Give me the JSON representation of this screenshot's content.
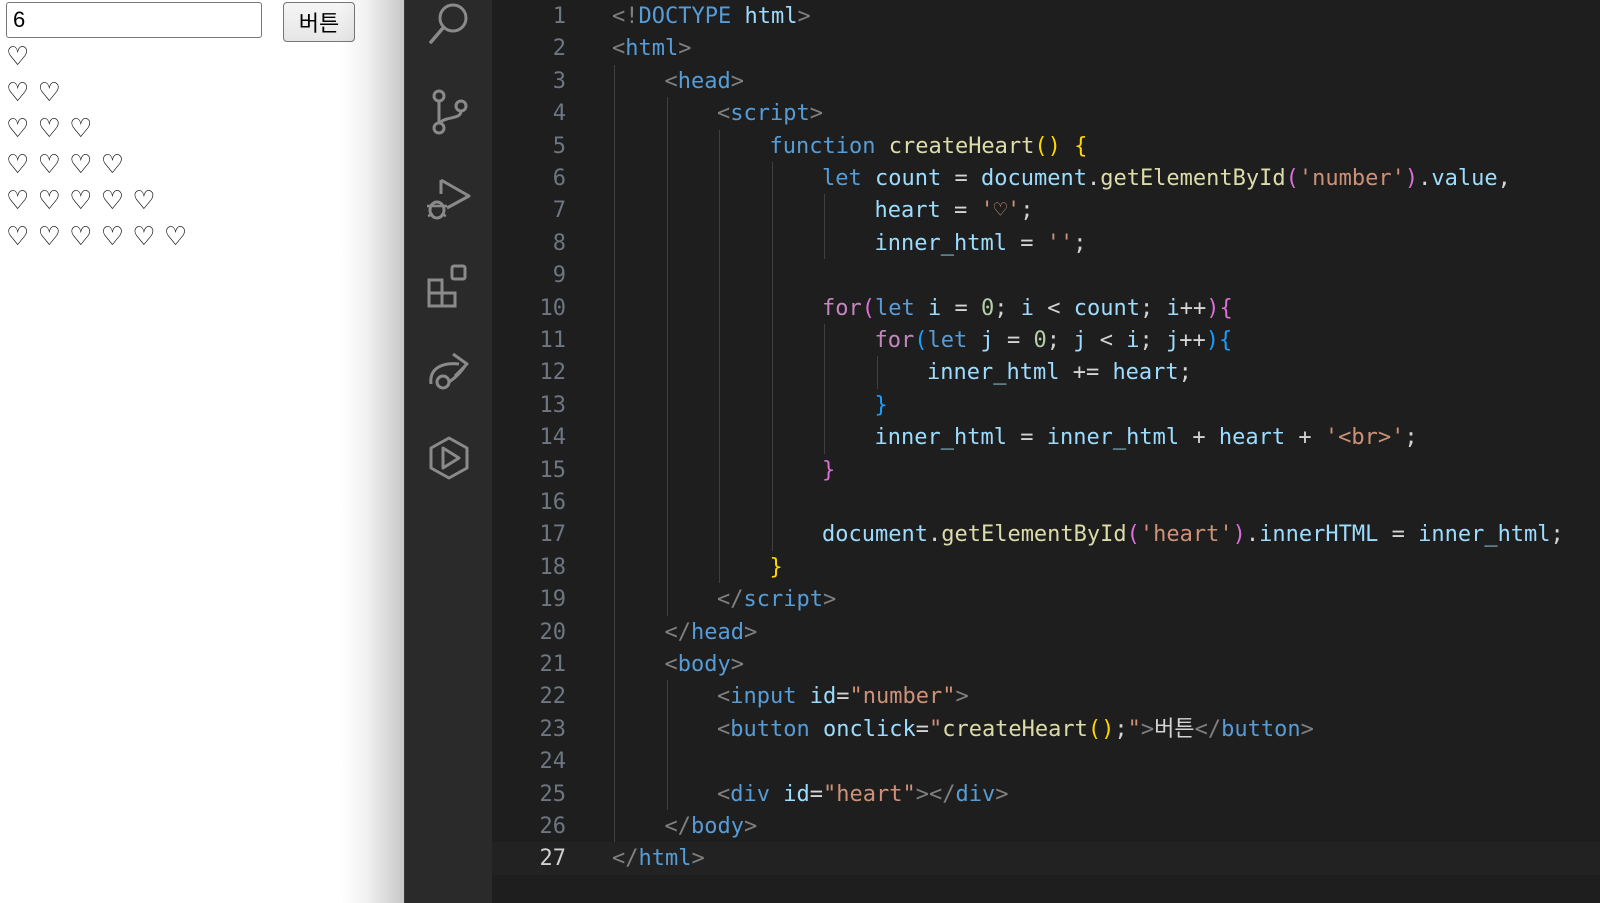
{
  "preview": {
    "input_value": "6",
    "button_label": "버튼",
    "heart_rows": [
      "♡",
      "♡♡",
      "♡♡♡",
      "♡♡♡♡",
      "♡♡♡♡♡",
      "♡♡♡♡♡♡"
    ]
  },
  "activity_bar": {
    "icons": [
      "search-icon",
      "source-control-icon",
      "run-debug-icon",
      "extensions-icon",
      "live-share-icon",
      "remote-explorer-icon"
    ]
  },
  "editor": {
    "active_line": 27,
    "lines": [
      {
        "n": "1",
        "indent": 0,
        "tokens": [
          [
            "br",
            "<!"
          ],
          [
            "tag",
            "DOCTYPE"
          ],
          [
            "txt",
            " "
          ],
          [
            "attr",
            "html"
          ],
          [
            "br",
            ">"
          ]
        ]
      },
      {
        "n": "2",
        "indent": 0,
        "tokens": [
          [
            "br",
            "<"
          ],
          [
            "tag",
            "html"
          ],
          [
            "br",
            ">"
          ]
        ]
      },
      {
        "n": "3",
        "indent": 1,
        "tokens": [
          [
            "br",
            "<"
          ],
          [
            "tag",
            "head"
          ],
          [
            "br",
            ">"
          ]
        ]
      },
      {
        "n": "4",
        "indent": 2,
        "tokens": [
          [
            "br",
            "<"
          ],
          [
            "tag",
            "script"
          ],
          [
            "br",
            ">"
          ]
        ]
      },
      {
        "n": "5",
        "indent": 3,
        "tokens": [
          [
            "kw",
            "function"
          ],
          [
            "txt",
            " "
          ],
          [
            "fn",
            "createHeart"
          ],
          [
            "y",
            "()"
          ],
          [
            "txt",
            " "
          ],
          [
            "y",
            "{"
          ]
        ]
      },
      {
        "n": "6",
        "indent": 4,
        "tokens": [
          [
            "kw",
            "let"
          ],
          [
            "txt",
            " "
          ],
          [
            "var",
            "count"
          ],
          [
            "txt",
            " = "
          ],
          [
            "var",
            "document"
          ],
          [
            "txt",
            "."
          ],
          [
            "fn",
            "getElementById"
          ],
          [
            "p",
            "("
          ],
          [
            "str",
            "'number'"
          ],
          [
            "p",
            ")"
          ],
          [
            "txt",
            "."
          ],
          [
            "var",
            "value"
          ],
          [
            "txt",
            ","
          ]
        ]
      },
      {
        "n": "7",
        "indent": 5,
        "tokens": [
          [
            "var",
            "heart"
          ],
          [
            "txt",
            " = "
          ],
          [
            "str",
            "'♡'"
          ],
          [
            "txt",
            ";"
          ]
        ]
      },
      {
        "n": "8",
        "indent": 5,
        "tokens": [
          [
            "var",
            "inner_html"
          ],
          [
            "txt",
            " = "
          ],
          [
            "str",
            "''"
          ],
          [
            "txt",
            ";"
          ]
        ]
      },
      {
        "n": "9",
        "indent": 4,
        "tokens": []
      },
      {
        "n": "10",
        "indent": 4,
        "tokens": [
          [
            "ctl",
            "for"
          ],
          [
            "p",
            "("
          ],
          [
            "kw",
            "let"
          ],
          [
            "txt",
            " "
          ],
          [
            "var",
            "i"
          ],
          [
            "txt",
            " = "
          ],
          [
            "num",
            "0"
          ],
          [
            "txt",
            "; "
          ],
          [
            "var",
            "i"
          ],
          [
            "txt",
            " < "
          ],
          [
            "var",
            "count"
          ],
          [
            "txt",
            "; "
          ],
          [
            "var",
            "i"
          ],
          [
            "txt",
            "++"
          ],
          [
            "p",
            ")"
          ],
          [
            "p",
            "{"
          ]
        ]
      },
      {
        "n": "11",
        "indent": 5,
        "tokens": [
          [
            "ctl",
            "for"
          ],
          [
            "b",
            "("
          ],
          [
            "kw",
            "let"
          ],
          [
            "txt",
            " "
          ],
          [
            "var",
            "j"
          ],
          [
            "txt",
            " = "
          ],
          [
            "num",
            "0"
          ],
          [
            "txt",
            "; "
          ],
          [
            "var",
            "j"
          ],
          [
            "txt",
            " < "
          ],
          [
            "var",
            "i"
          ],
          [
            "txt",
            "; "
          ],
          [
            "var",
            "j"
          ],
          [
            "txt",
            "++"
          ],
          [
            "b",
            ")"
          ],
          [
            "b",
            "{"
          ]
        ]
      },
      {
        "n": "12",
        "indent": 6,
        "tokens": [
          [
            "var",
            "inner_html"
          ],
          [
            "txt",
            " += "
          ],
          [
            "var",
            "heart"
          ],
          [
            "txt",
            ";"
          ]
        ]
      },
      {
        "n": "13",
        "indent": 5,
        "tokens": [
          [
            "b",
            "}"
          ]
        ]
      },
      {
        "n": "14",
        "indent": 5,
        "tokens": [
          [
            "var",
            "inner_html"
          ],
          [
            "txt",
            " = "
          ],
          [
            "var",
            "inner_html"
          ],
          [
            "txt",
            " + "
          ],
          [
            "var",
            "heart"
          ],
          [
            "txt",
            " + "
          ],
          [
            "str",
            "'<br>'"
          ],
          [
            "txt",
            ";"
          ]
        ]
      },
      {
        "n": "15",
        "indent": 4,
        "tokens": [
          [
            "p",
            "}"
          ]
        ]
      },
      {
        "n": "16",
        "indent": 4,
        "tokens": []
      },
      {
        "n": "17",
        "indent": 4,
        "tokens": [
          [
            "var",
            "document"
          ],
          [
            "txt",
            "."
          ],
          [
            "fn",
            "getElementById"
          ],
          [
            "p",
            "("
          ],
          [
            "str",
            "'heart'"
          ],
          [
            "p",
            ")"
          ],
          [
            "txt",
            "."
          ],
          [
            "var",
            "innerHTML"
          ],
          [
            "txt",
            " = "
          ],
          [
            "var",
            "inner_html"
          ],
          [
            "txt",
            ";"
          ]
        ]
      },
      {
        "n": "18",
        "indent": 3,
        "tokens": [
          [
            "y",
            "}"
          ]
        ]
      },
      {
        "n": "19",
        "indent": 2,
        "tokens": [
          [
            "br",
            "</"
          ],
          [
            "tag",
            "script"
          ],
          [
            "br",
            ">"
          ]
        ]
      },
      {
        "n": "20",
        "indent": 1,
        "tokens": [
          [
            "br",
            "</"
          ],
          [
            "tag",
            "head"
          ],
          [
            "br",
            ">"
          ]
        ]
      },
      {
        "n": "21",
        "indent": 1,
        "tokens": [
          [
            "br",
            "<"
          ],
          [
            "tag",
            "body"
          ],
          [
            "br",
            ">"
          ]
        ]
      },
      {
        "n": "22",
        "indent": 2,
        "tokens": [
          [
            "br",
            "<"
          ],
          [
            "tag",
            "input"
          ],
          [
            "txt",
            " "
          ],
          [
            "attr",
            "id"
          ],
          [
            "txt",
            "="
          ],
          [
            "str",
            "\"number\""
          ],
          [
            "br",
            ">"
          ]
        ]
      },
      {
        "n": "23",
        "indent": 2,
        "tokens": [
          [
            "br",
            "<"
          ],
          [
            "tag",
            "button"
          ],
          [
            "txt",
            " "
          ],
          [
            "attr",
            "onclick"
          ],
          [
            "txt",
            "="
          ],
          [
            "str",
            "\""
          ],
          [
            "fn",
            "createHeart"
          ],
          [
            "y",
            "()"
          ],
          [
            "txt",
            ";"
          ],
          [
            "str",
            "\""
          ],
          [
            "br",
            ">"
          ],
          [
            "txt",
            "버튼"
          ],
          [
            "br",
            "</"
          ],
          [
            "tag",
            "button"
          ],
          [
            "br",
            ">"
          ]
        ]
      },
      {
        "n": "24",
        "indent": 2,
        "tokens": []
      },
      {
        "n": "25",
        "indent": 2,
        "tokens": [
          [
            "br",
            "<"
          ],
          [
            "tag",
            "div"
          ],
          [
            "txt",
            " "
          ],
          [
            "attr",
            "id"
          ],
          [
            "txt",
            "="
          ],
          [
            "str",
            "\"heart\""
          ],
          [
            "br",
            "></"
          ],
          [
            "tag",
            "div"
          ],
          [
            "br",
            ">"
          ]
        ]
      },
      {
        "n": "26",
        "indent": 1,
        "tokens": [
          [
            "br",
            "</"
          ],
          [
            "tag",
            "body"
          ],
          [
            "br",
            ">"
          ]
        ]
      },
      {
        "n": "27",
        "indent": 0,
        "tokens": [
          [
            "br",
            "</"
          ],
          [
            "tag",
            "html"
          ],
          [
            "br",
            ">"
          ]
        ]
      }
    ]
  }
}
